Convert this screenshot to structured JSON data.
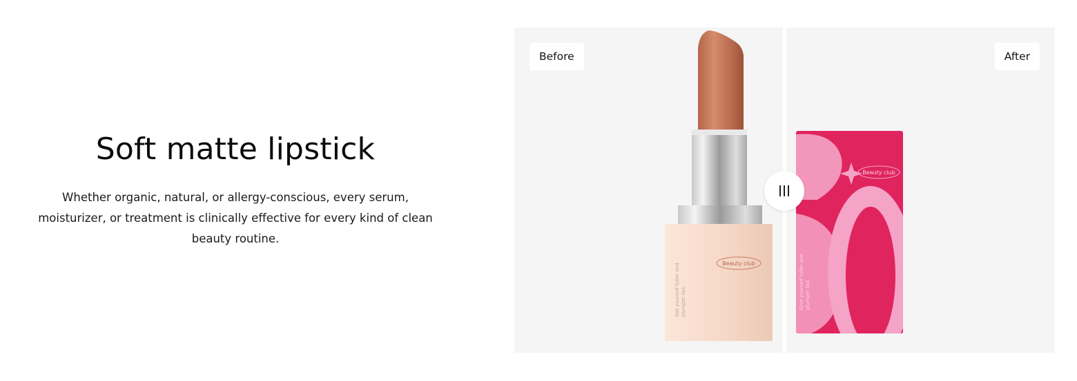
{
  "section": {
    "title": "Soft matte lipstick",
    "description": "Whether organic, natural, or allergy-conscious, every serum, moisturizer, or treatment is clinically effective for every kind of clean beauty routine."
  },
  "comparison": {
    "before_label": "Before",
    "after_label": "After",
    "handle_icon": "drag-handle-bars-icon",
    "before_product": {
      "brand": "Beauty club",
      "tagline_line1": "Get yourself fuller and",
      "tagline_line2": "plumper lips."
    },
    "after_product": {
      "brand": "Beauty club",
      "tagline_line1": "Give yourself fuller and",
      "tagline_line2": "plumper lips."
    }
  },
  "colors": {
    "panel_bg": "#f5f5f5",
    "lipstick_bullet": "#c97a5c",
    "box_peach": "#f6d9c8",
    "box_pink": "#e0245e",
    "box_light_pink": "#f5a3c7"
  }
}
